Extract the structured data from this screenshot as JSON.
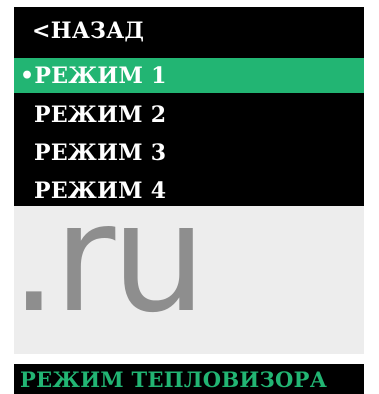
{
  "menu": {
    "back_label": "<НАЗАД",
    "items": [
      {
        "label": "•РЕЖИМ 1",
        "selected": true
      },
      {
        "label": "РЕЖИМ 2",
        "selected": false
      },
      {
        "label": "РЕЖИМ 3",
        "selected": false
      },
      {
        "label": "РЕЖИМ 4",
        "selected": false
      }
    ]
  },
  "watermark": {
    "text": ".ru"
  },
  "status": {
    "label": "РЕЖИМ ТЕПЛОВИЗОРА"
  },
  "colors": {
    "panel_bg": "#000000",
    "accent": "#22b573",
    "menu_text": "#ffffff",
    "watermark": "#8e8e8e",
    "watermark_bg": "#ededed"
  }
}
